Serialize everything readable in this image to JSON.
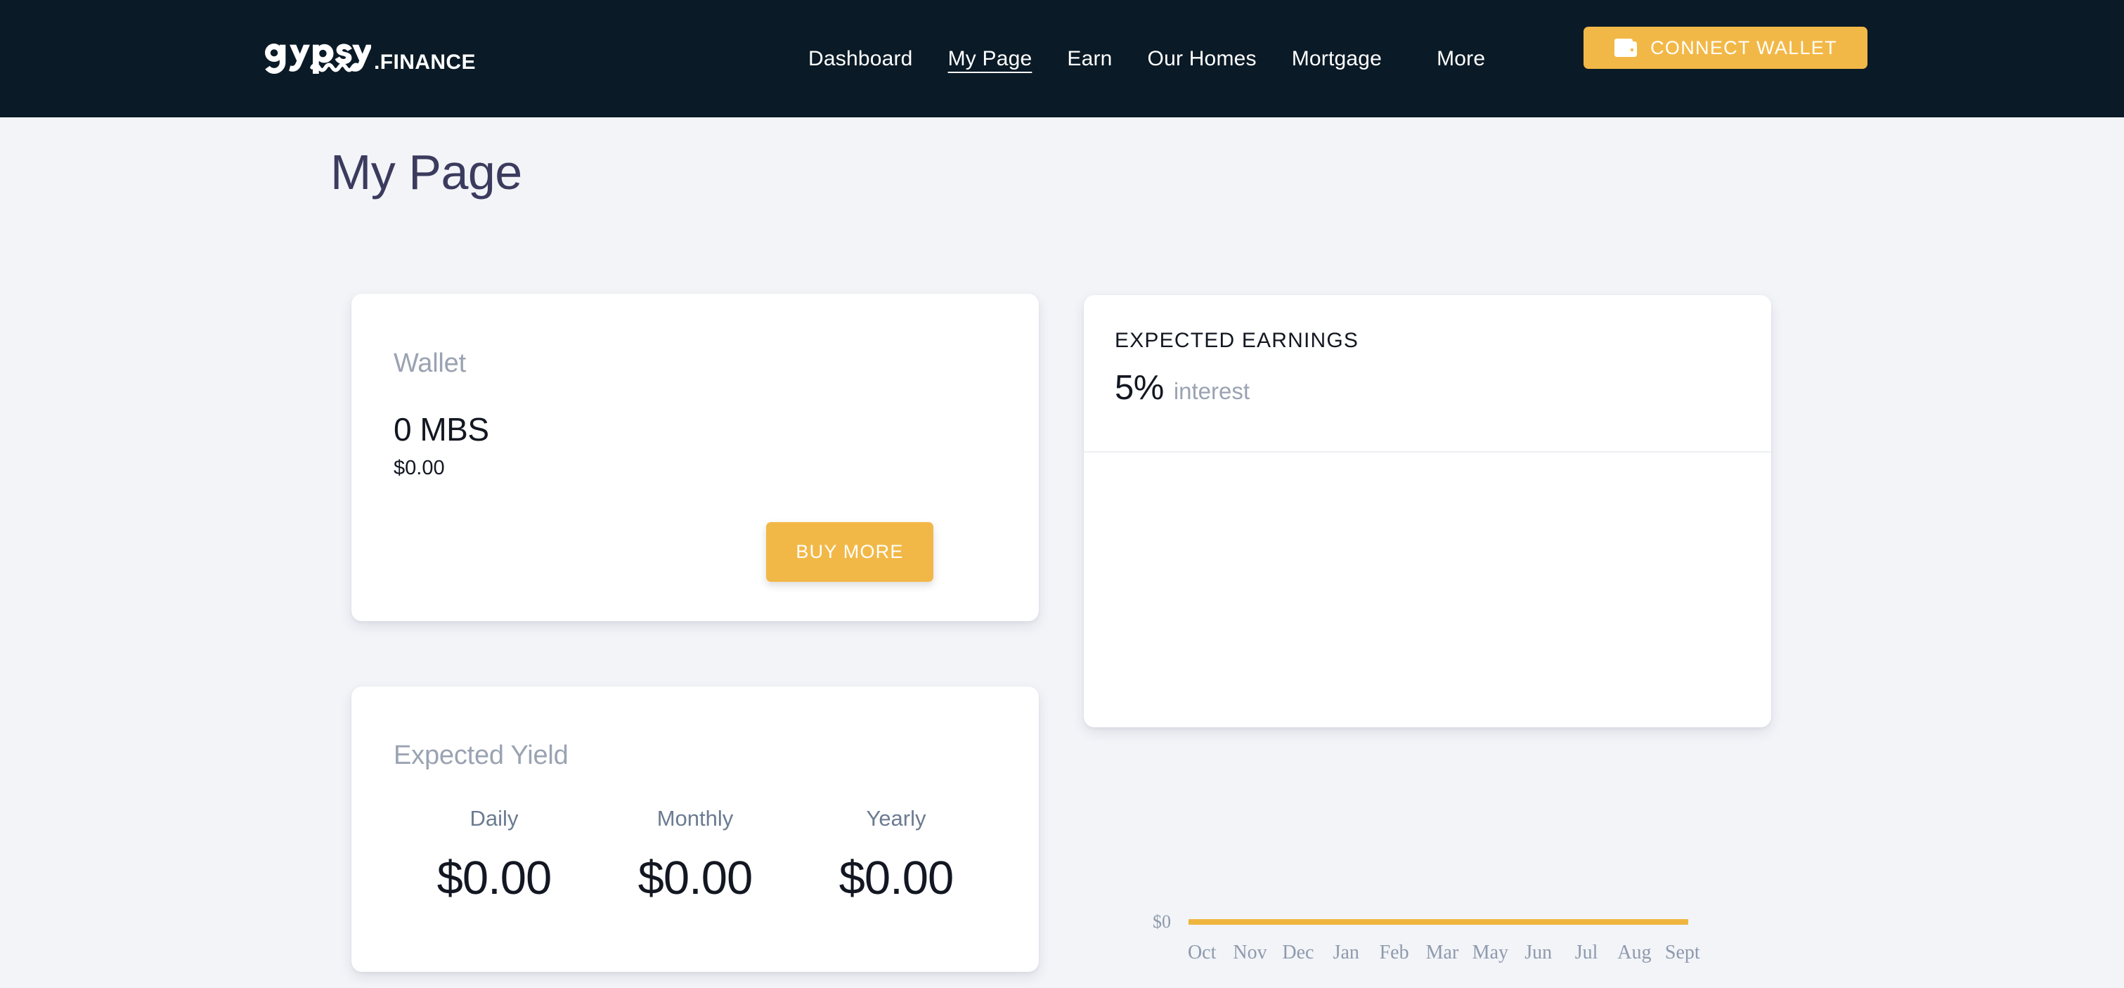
{
  "header": {
    "logo": {
      "name": "gypsy",
      "suffix": ".FINANCE"
    },
    "nav": [
      {
        "label": "Dashboard",
        "active": false
      },
      {
        "label": "My Page",
        "active": true
      },
      {
        "label": "Earn",
        "active": false
      },
      {
        "label": "Our Homes",
        "active": false
      },
      {
        "label": "Mortgage",
        "active": false
      },
      {
        "label": "More",
        "active": false
      }
    ],
    "connect_wallet": {
      "label": "CONNECT WALLET",
      "icon": "wallet-icon"
    },
    "background_color": "#0A1A26",
    "accent_color": "#F2B847"
  },
  "page": {
    "title": "My Page",
    "background_color": "#F2F4F8",
    "title_color": "#3B3B5E"
  },
  "wallet_card": {
    "title": "Wallet",
    "amount": "0 MBS",
    "usd_value": "$0.00",
    "buy_button": "BUY MORE"
  },
  "yield_card": {
    "title": "Expected Yield",
    "columns": [
      {
        "label": "Daily",
        "value": "$0.00"
      },
      {
        "label": "Monthly",
        "value": "$0.00"
      },
      {
        "label": "Yearly",
        "value": "$0.00"
      }
    ]
  },
  "earnings_card": {
    "title": "EXPECTED EARNINGS",
    "rate": "5%",
    "rate_suffix": "interest"
  },
  "chart_data": {
    "type": "line",
    "title": "EXPECTED EARNINGS",
    "xlabel": "",
    "ylabel": "",
    "categories": [
      "Oct",
      "Nov",
      "Dec",
      "Jan",
      "Feb",
      "Mar",
      "May",
      "Jun",
      "Jul",
      "Aug",
      "Sept"
    ],
    "values": [
      0,
      0,
      0,
      0,
      0,
      0,
      0,
      0,
      0,
      0,
      0
    ],
    "ytick_labels": [
      "$0"
    ],
    "ylim": [
      0,
      0
    ],
    "grid": false,
    "legend": false,
    "line_color": "#EEB53F",
    "tick_color": "#8E9AAC"
  }
}
